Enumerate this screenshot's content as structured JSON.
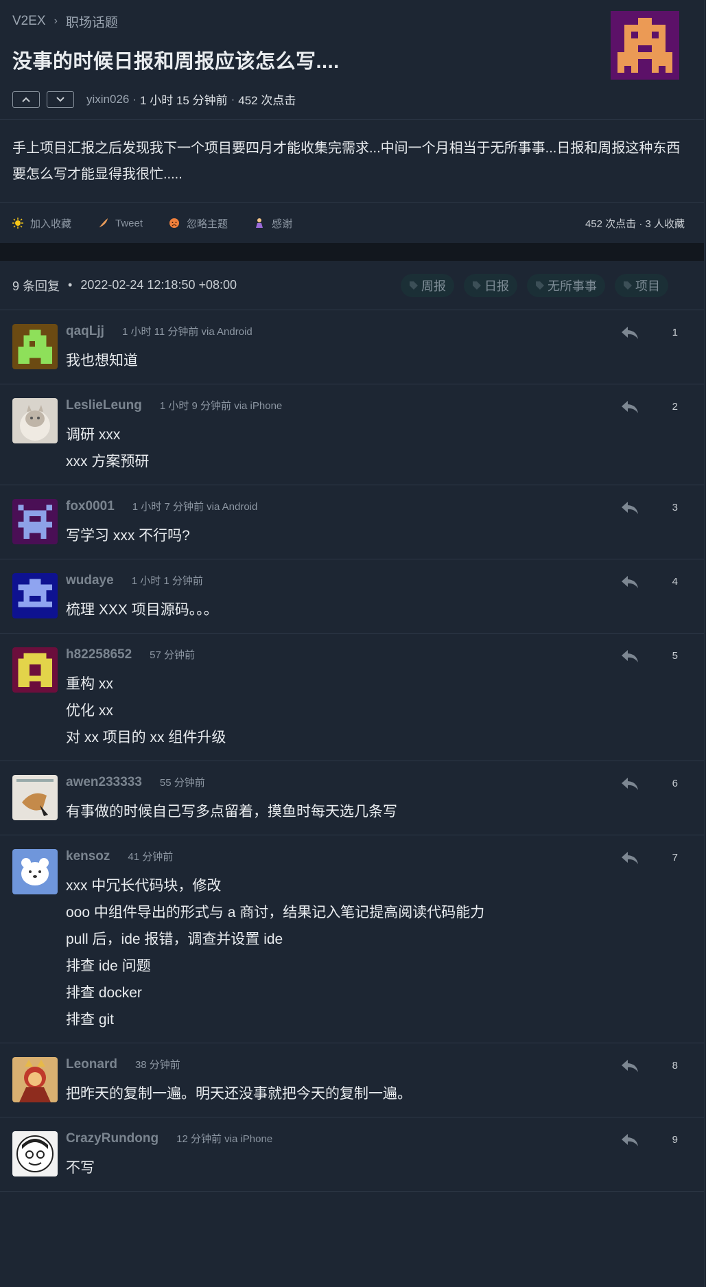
{
  "breadcrumb": {
    "site": "V2EX",
    "sep": "›",
    "node": "职场话题"
  },
  "topic": {
    "title": "没事的时候日报和周报应该怎么写....",
    "author": "yixin026",
    "dot1": "·",
    "time": "1 小时 15 分钟前",
    "dot2": "·",
    "clicks": "452 次点击",
    "content": "手上项目汇报之后发现我下一个项目要四月才能收集完需求...中间一个月相当于无所事事...日报和周报这种东西要怎么写才能显得我很忙....."
  },
  "actions": {
    "favorite": "加入收藏",
    "tweet": "Tweet",
    "ignore": "忽略主题",
    "thanks": "感谢",
    "stats": "452 次点击  ·  3 人收藏"
  },
  "replies_header": {
    "count": "9 条回复",
    "bullet": "•",
    "date": "2022-02-24 12:18:50 +08:00",
    "tags": [
      "周报",
      "日报",
      "无所事事",
      "项目"
    ]
  },
  "colors": {
    "accent_tag_bg": "#1b2f36",
    "page_bg": "#1d2633"
  },
  "replies": [
    {
      "user": "qaqLjj",
      "time": "1 小时 11 分钟前 via Android",
      "floor": "1",
      "lines": [
        "我也想知道"
      ]
    },
    {
      "user": "LeslieLeung",
      "time": "1 小时 9 分钟前 via iPhone",
      "floor": "2",
      "lines": [
        "调研 xxx",
        "xxx 方案预研"
      ]
    },
    {
      "user": "fox0001",
      "time": "1 小时 7 分钟前 via Android",
      "floor": "3",
      "lines": [
        "写学习 xxx 不行吗?"
      ]
    },
    {
      "user": "wudaye",
      "time": "1 小时 1 分钟前",
      "floor": "4",
      "lines": [
        "梳理 XXX 项目源码。。。"
      ]
    },
    {
      "user": "h82258652",
      "time": "57 分钟前",
      "floor": "5",
      "lines": [
        "重构 xx",
        "优化 xx",
        "对 xx 项目的 xx 组件升级"
      ]
    },
    {
      "user": "awen233333",
      "time": "55 分钟前",
      "floor": "6",
      "lines": [
        "有事做的时候自己写多点留着，摸鱼时每天选几条写"
      ]
    },
    {
      "user": "kensoz",
      "time": "41 分钟前",
      "floor": "7",
      "lines": [
        "xxx 中冗长代码块，修改",
        "ooo 中组件导出的形式与 a 商讨，结果记入笔记提高阅读代码能力",
        "pull 后，ide 报错，调查并设置 ide",
        "排查 ide 问题",
        "排查 docker",
        "排查 git"
      ]
    },
    {
      "user": "Leonard",
      "time": "38 分钟前",
      "floor": "8",
      "lines": [
        "把昨天的复制一遍。明天还没事就把今天的复制一遍。"
      ]
    },
    {
      "user": "CrazyRundong",
      "time": "12 分钟前 via iPhone",
      "floor": "9",
      "lines": [
        "不写"
      ]
    }
  ]
}
